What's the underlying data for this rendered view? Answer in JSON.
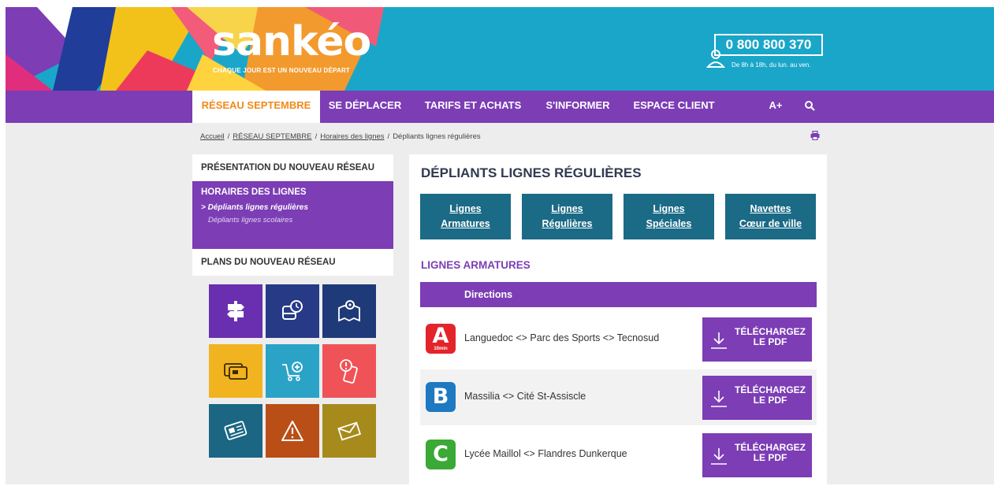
{
  "header": {
    "logo": "sankéo",
    "tagline": "CHAQUE JOUR EST UN NOUVEAU DÉPART",
    "phone": "0 800 800 370",
    "phone_hours": "De 8h à 18h, du lun. au ven."
  },
  "nav": {
    "items": [
      {
        "label": "RÉSEAU SEPTEMBRE",
        "active": true
      },
      {
        "label": "SE DÉPLACER"
      },
      {
        "label": "TARIFS ET ACHATS"
      },
      {
        "label": "S'INFORMER"
      },
      {
        "label": "ESPACE CLIENT"
      },
      {
        "label": "A+"
      }
    ]
  },
  "breadcrumb": {
    "home": "Accueil",
    "level1": "RÉSEAU SEPTEMBRE",
    "level2": "Horaires des lignes",
    "current": "Dépliants lignes régulières",
    "separator": "/"
  },
  "sidebar": {
    "presentation": "PRÉSENTATION DU NOUVEAU RÉSEAU",
    "horaires": "HORAIRES DES LIGNES",
    "sub_active": "> Dépliants lignes régulières",
    "sub_other": "Dépliants lignes scolaires",
    "plans": "PLANS DU NOUVEAU RÉSEAU"
  },
  "tiles": [
    {
      "icon": "signpost-icon",
      "color": "#6a2fb0"
    },
    {
      "icon": "bus-clock-icon",
      "color": "#263a86"
    },
    {
      "icon": "map-pin-icon",
      "color": "#1f3a78"
    },
    {
      "icon": "card-icon",
      "color": "#f2b320"
    },
    {
      "icon": "cart-icon",
      "color": "#2ba3c7"
    },
    {
      "icon": "phone-alert-icon",
      "color": "#f05357"
    },
    {
      "icon": "newspaper-icon",
      "color": "#1a6683"
    },
    {
      "icon": "warning-icon",
      "color": "#b94e17"
    },
    {
      "icon": "envelope-icon",
      "color": "#a68a1c"
    }
  ],
  "main": {
    "title": "DÉPLIANTS LIGNES RÉGULIÈRES",
    "categories": [
      {
        "line1": "Lignes",
        "line2": "Armatures"
      },
      {
        "line1": "Lignes",
        "line2": "Régulières"
      },
      {
        "line1": "Lignes",
        "line2": "Spéciales"
      },
      {
        "line1": "Navettes",
        "line2": "Cœur de ville"
      }
    ],
    "section_title": "LIGNES ARMATURES",
    "table_header": "Directions",
    "rows": [
      {
        "badge": "A",
        "badge_sub": "10min",
        "badge_color": "#e3242b",
        "text": "Languedoc <> Parc des Sports <> Tecnosud"
      },
      {
        "badge": "B",
        "badge_color": "#1f78c2",
        "text": "Massilia <> Cité St-Assiscle"
      },
      {
        "badge": "C",
        "badge_color": "#3aa935",
        "text": "Lycée Maillol <> Flandres Dunkerque"
      }
    ],
    "download_line1": "TÉLÉCHARGEZ",
    "download_line2": "LE PDF"
  },
  "colors": {
    "purple": "#7c3db5",
    "cyan": "#1aa6c9",
    "orange": "#f08a1c",
    "teal": "#1b6a86"
  }
}
